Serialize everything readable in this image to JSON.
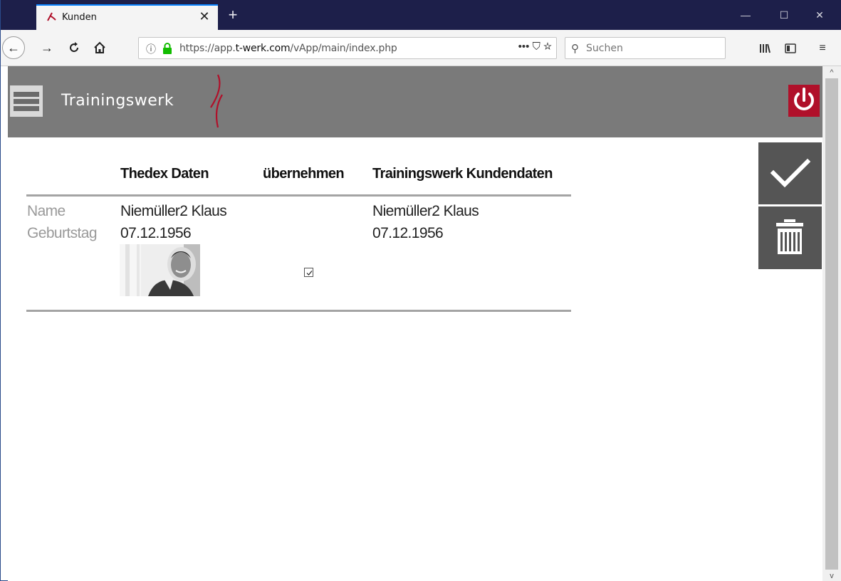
{
  "browser": {
    "tab_title": "Kunden",
    "url_prefix": "https://app.",
    "url_domain": "t-werk.com",
    "url_path": "/vApp/main/index.php",
    "url_actions": "••• ⛉ ☆",
    "search_placeholder": "Suchen"
  },
  "app": {
    "brand": "Trainingswerk",
    "accent_color": "#b0102a",
    "header_color": "#7a7a7a"
  },
  "table": {
    "headers": {
      "thedex": "Thedex Daten",
      "uebernehmen": "übernehmen",
      "trainingswerk": "Trainingswerk Kundendaten"
    },
    "rows": [
      {
        "label": "Name",
        "thedex": "Niemüller2 Klaus",
        "trainingswerk": "Niemüller2 Klaus"
      },
      {
        "label": "Geburtstag",
        "thedex": "07.12.1956",
        "trainingswerk": "07.12.1956"
      }
    ],
    "photo_checkbox_checked": true
  },
  "icons": [
    "menu-icon",
    "power-icon",
    "check-icon",
    "trash-icon",
    "search-icon",
    "lock-icon",
    "home-icon",
    "reload-icon"
  ]
}
